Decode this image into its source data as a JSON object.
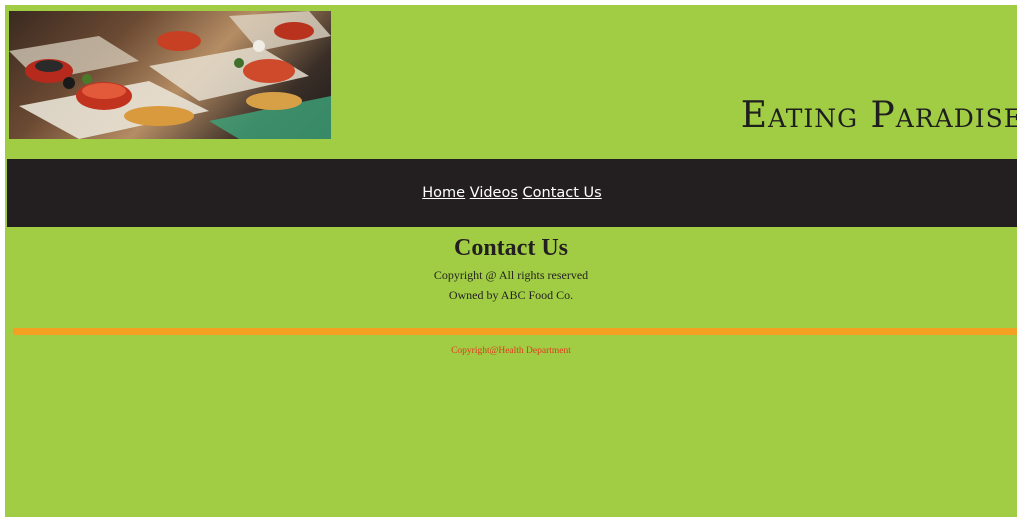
{
  "header": {
    "site_title": "Eating Paradise",
    "banner_image": "food-appetizers-banner"
  },
  "nav": {
    "items": [
      {
        "label": "Home"
      },
      {
        "label": "Videos"
      },
      {
        "label": "Contact Us"
      }
    ]
  },
  "main": {
    "heading": "Contact Us",
    "copyright": "Copyright @ All rights reserved",
    "owner": "Owned by ABC Food Co."
  },
  "footer": {
    "text": "Copyright@Health Department"
  },
  "colors": {
    "page_background": "#a1cd44",
    "navbar": "#231f20",
    "rule": "#f4a020",
    "footer_text": "#e03a1f"
  }
}
